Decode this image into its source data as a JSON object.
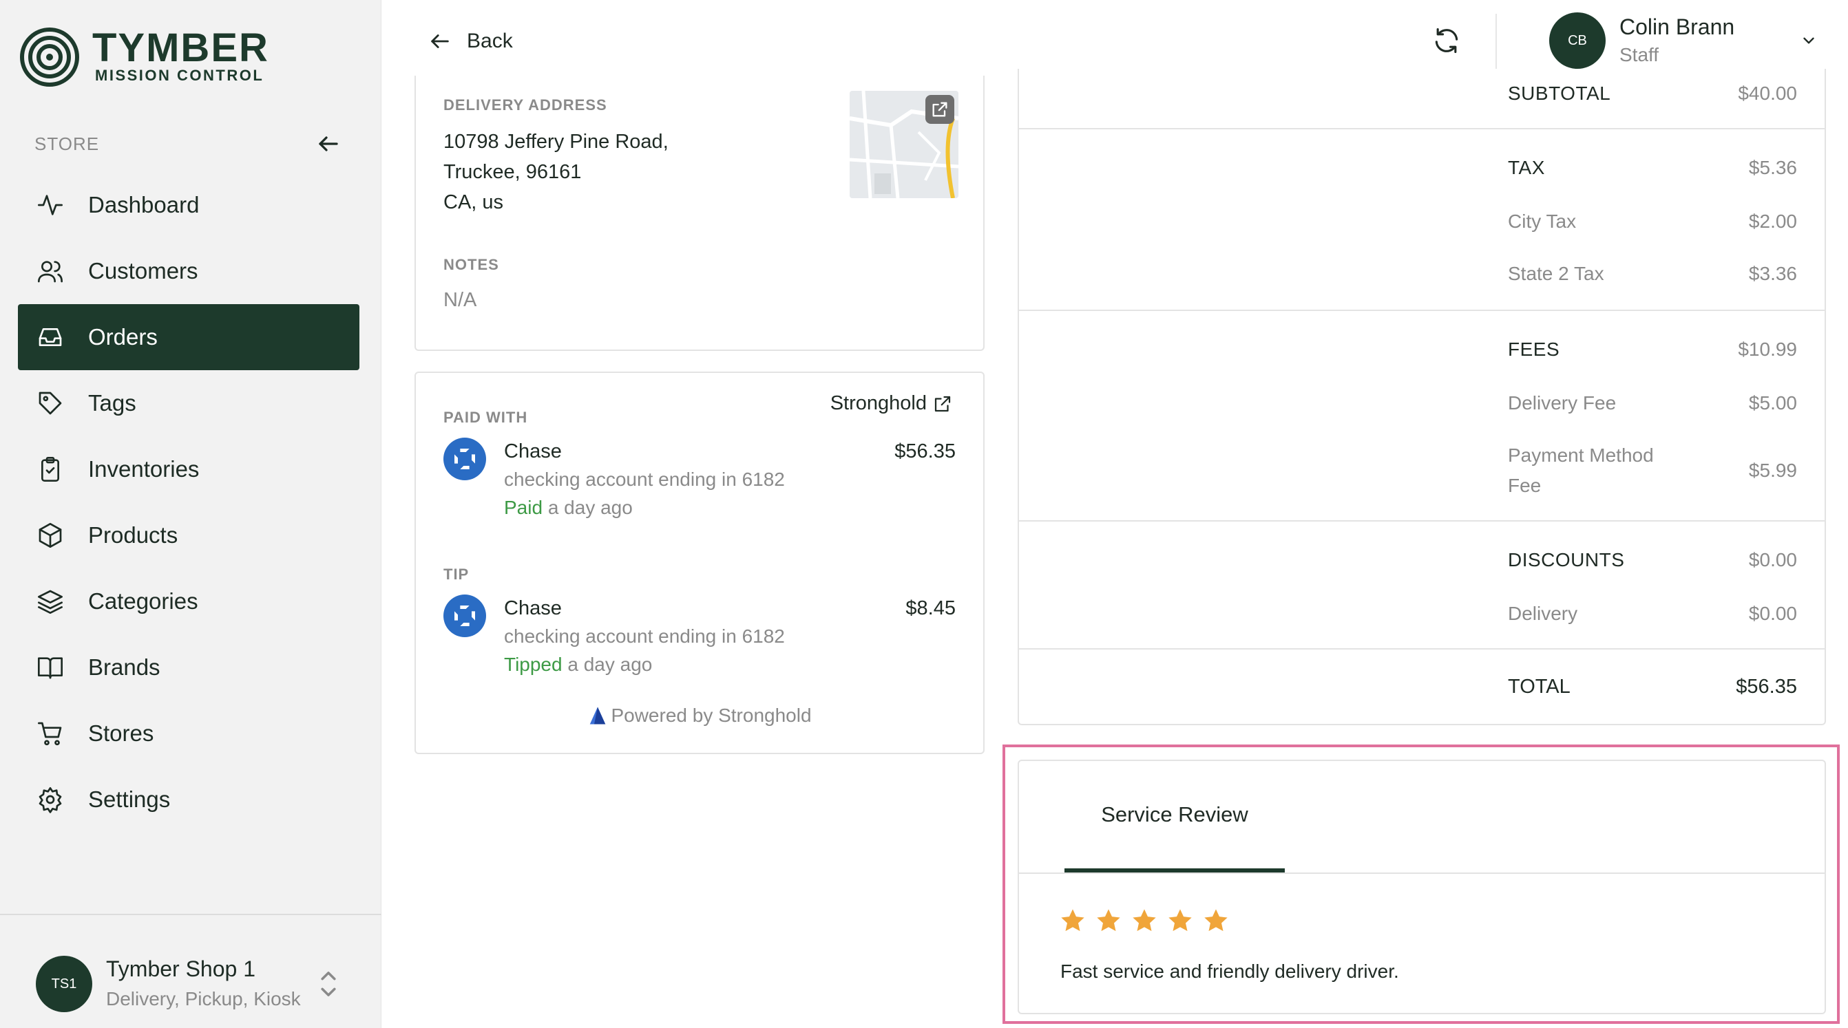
{
  "brand": {
    "name": "TYMBER",
    "subtitle": "MISSION CONTROL"
  },
  "sidebar": {
    "section_label": "STORE",
    "items": [
      {
        "label": "Dashboard",
        "icon": "activity-icon",
        "active": false
      },
      {
        "label": "Customers",
        "icon": "users-icon",
        "active": false
      },
      {
        "label": "Orders",
        "icon": "inbox-icon",
        "active": true
      },
      {
        "label": "Tags",
        "icon": "tag-icon",
        "active": false
      },
      {
        "label": "Inventories",
        "icon": "clipboard-check-icon",
        "active": false
      },
      {
        "label": "Products",
        "icon": "box-icon",
        "active": false
      },
      {
        "label": "Categories",
        "icon": "layers-icon",
        "active": false
      },
      {
        "label": "Brands",
        "icon": "book-open-icon",
        "active": false
      },
      {
        "label": "Stores",
        "icon": "cart-icon",
        "active": false
      },
      {
        "label": "Settings",
        "icon": "gear-icon",
        "active": false
      }
    ],
    "shop": {
      "initials": "TS1",
      "name": "Tymber Shop 1",
      "types": "Delivery, Pickup, Kiosk"
    }
  },
  "topbar": {
    "back_label": "Back",
    "user": {
      "initials": "CB",
      "name": "Colin Brann",
      "role": "Staff"
    }
  },
  "delivery": {
    "address_label": "DELIVERY ADDRESS",
    "address_lines": [
      "10798 Jeffery Pine Road,",
      "Truckee, 96161",
      "CA, us"
    ],
    "notes_label": "NOTES",
    "notes_value": "N/A"
  },
  "payment": {
    "provider_link": "Stronghold",
    "paid_with_label": "PAID WITH",
    "paid": {
      "bank": "Chase",
      "account": "checking account ending in 6182",
      "status_word": "Paid",
      "status_time": "a day ago",
      "amount": "$56.35"
    },
    "tip_label": "TIP",
    "tip": {
      "bank": "Chase",
      "account": "checking account ending in 6182",
      "status_word": "Tipped",
      "status_time": "a day ago",
      "amount": "$8.45"
    },
    "powered_by": "Powered by Stronghold"
  },
  "summary": {
    "subtotal": {
      "label": "SUBTOTAL",
      "value": "$40.00"
    },
    "tax": {
      "label": "TAX",
      "value": "$5.36",
      "items": [
        {
          "label": "City Tax",
          "value": "$2.00"
        },
        {
          "label": "State 2 Tax",
          "value": "$3.36"
        }
      ]
    },
    "fees": {
      "label": "FEES",
      "value": "$10.99",
      "items": [
        {
          "label": "Delivery Fee",
          "value": "$5.00"
        },
        {
          "label": "Payment Method",
          "label2": "Fee",
          "value": "$5.99"
        }
      ]
    },
    "discounts": {
      "label": "DISCOUNTS",
      "value": "$0.00",
      "items": [
        {
          "label": "Delivery",
          "value": "$0.00"
        }
      ]
    },
    "total": {
      "label": "TOTAL",
      "value": "$56.35"
    }
  },
  "review": {
    "tab_label": "Service Review",
    "rating": 5,
    "rating_max": 5,
    "text": "Fast service and friendly delivery driver."
  },
  "colors": {
    "primary": "#1d3a2c",
    "success": "#3d9a45",
    "star": "#f0a53a",
    "highlight": "#e0719c",
    "bank": "#2a6cc4"
  }
}
